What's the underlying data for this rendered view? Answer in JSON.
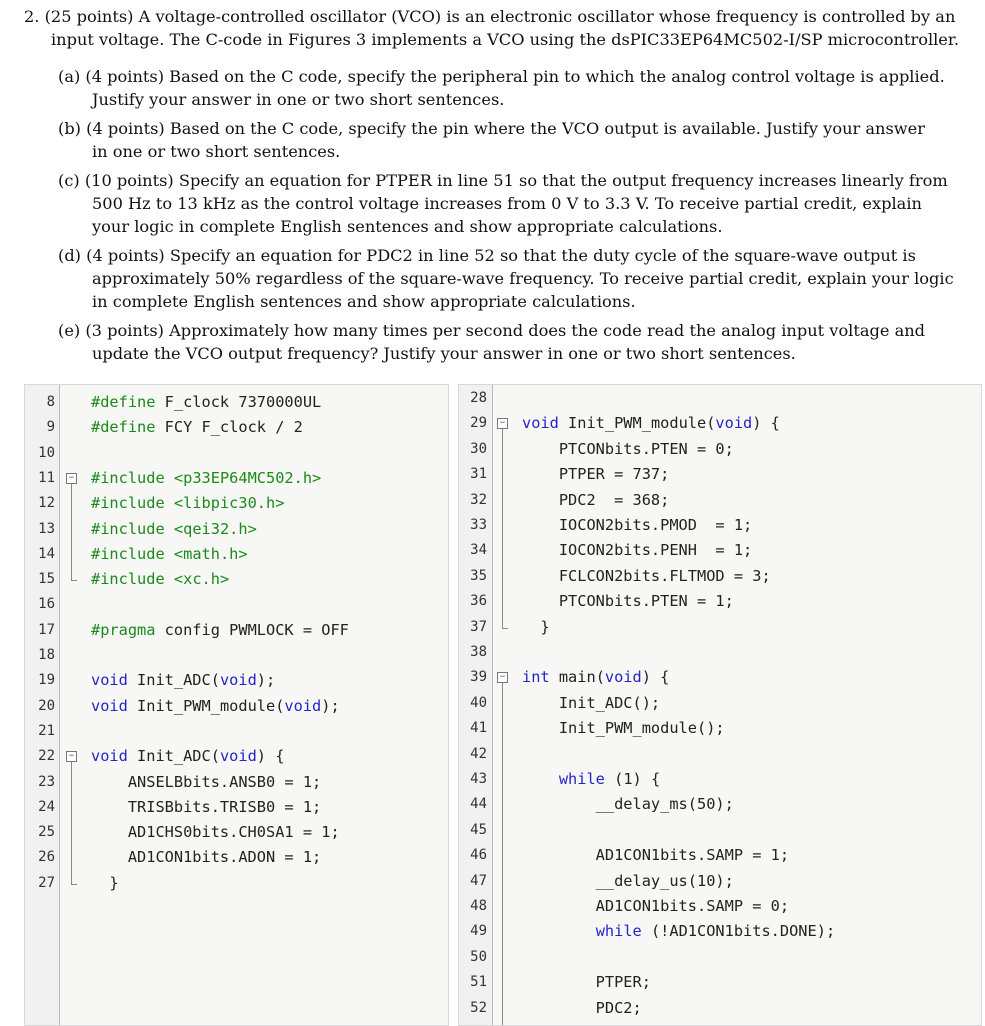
{
  "question": {
    "lines": [
      "2. (25 points) A voltage-controlled oscillator (VCO) is an electronic oscillator whose frequency is controlled by an",
      "input voltage. The C-code in Figures 3 implements a VCO using the dsPIC33EP64MC502-I/SP microcontroller.",
      "(a) (4 points) Based on the C code, specify the peripheral pin to which the analog control voltage is applied.",
      "Justify your answer in one or two short sentences.",
      "(b) (4 points) Based on the C code, specify the pin where the VCO output is available. Justify your answer",
      "in one or two short sentences.",
      "(c) (10 points) Specify an equation for PTPER in line 51 so that the output frequency increases linearly from",
      "500 Hz to 13 kHz as the control voltage increases from 0 V to 3.3 V. To receive partial credit, explain",
      "your logic in complete English sentences and show appropriate calculations.",
      "(d) (4 points) Specify an equation for PDC2 in line 52 so that the duty cycle of the square-wave output is",
      "approximately 50% regardless of the square-wave frequency. To receive partial credit, explain your logic",
      "in complete English sentences and show appropriate calculations.",
      "(e) (3 points) Approximately how many times per second does the code read the analog input voltage and",
      "update the VCO output frequency? Justify your answer in one or two short sentences."
    ]
  },
  "colors": {
    "keyword": "#2424c8",
    "include": "#1b8a1b",
    "plain": "#222222"
  },
  "code_left": [
    {
      "n": "8",
      "t": "#define F_clock 7370000UL"
    },
    {
      "n": "9",
      "t": "#define FCY F_clock / 2"
    },
    {
      "n": "10",
      "t": ""
    },
    {
      "n": "11",
      "t": "#include <p33EP64MC502.h>"
    },
    {
      "n": "12",
      "t": "#include <libpic30.h>"
    },
    {
      "n": "13",
      "t": "#include <qei32.h>"
    },
    {
      "n": "14",
      "t": "#include <math.h>"
    },
    {
      "n": "15",
      "t": "#include <xc.h>"
    },
    {
      "n": "16",
      "t": ""
    },
    {
      "n": "17",
      "t": "#pragma config PWMLOCK = OFF"
    },
    {
      "n": "18",
      "t": ""
    },
    {
      "n": "19",
      "t": "void Init_ADC(void);"
    },
    {
      "n": "20",
      "t": "void Init_PWM_module(void);"
    },
    {
      "n": "21",
      "t": ""
    },
    {
      "n": "22",
      "t": "void Init_ADC(void) {"
    },
    {
      "n": "23",
      "t": "    ANSELBbits.ANSB0 = 1;"
    },
    {
      "n": "24",
      "t": "    TRISBbits.TRISB0 = 1;"
    },
    {
      "n": "25",
      "t": "    AD1CHS0bits.CH0SA1 = 1;"
    },
    {
      "n": "26",
      "t": "    AD1CON1bits.ADON = 1;"
    },
    {
      "n": "27",
      "t": "  }"
    }
  ],
  "code_right": [
    {
      "n": "28",
      "t": ""
    },
    {
      "n": "29",
      "t": "void Init_PWM_module(void) {"
    },
    {
      "n": "30",
      "t": "    PTCONbits.PTEN = 0;"
    },
    {
      "n": "31",
      "t": "    PTPER = 737;"
    },
    {
      "n": "32",
      "t": "    PDC2  = 368;"
    },
    {
      "n": "33",
      "t": "    IOCON2bits.PMOD  = 1;"
    },
    {
      "n": "34",
      "t": "    IOCON2bits.PENH  = 1;"
    },
    {
      "n": "35",
      "t": "    FCLCON2bits.FLTMOD = 3;"
    },
    {
      "n": "36",
      "t": "    PTCONbits.PTEN = 1;"
    },
    {
      "n": "37",
      "t": "  }"
    },
    {
      "n": "38",
      "t": ""
    },
    {
      "n": "39",
      "t": "int main(void) {"
    },
    {
      "n": "40",
      "t": "    Init_ADC();"
    },
    {
      "n": "41",
      "t": "    Init_PWM_module();"
    },
    {
      "n": "42",
      "t": ""
    },
    {
      "n": "43",
      "t": "    while (1) {"
    },
    {
      "n": "44",
      "t": "        __delay_ms(50);"
    },
    {
      "n": "45",
      "t": ""
    },
    {
      "n": "46",
      "t": "        AD1CON1bits.SAMP = 1;"
    },
    {
      "n": "47",
      "t": "        __delay_us(10);"
    },
    {
      "n": "48",
      "t": "        AD1CON1bits.SAMP = 0;"
    },
    {
      "n": "49",
      "t": "        while (!AD1CON1bits.DONE);"
    },
    {
      "n": "50",
      "t": ""
    },
    {
      "n": "51",
      "t": "        PTPER;"
    },
    {
      "n": "52",
      "t": "        PDC2;"
    }
  ]
}
